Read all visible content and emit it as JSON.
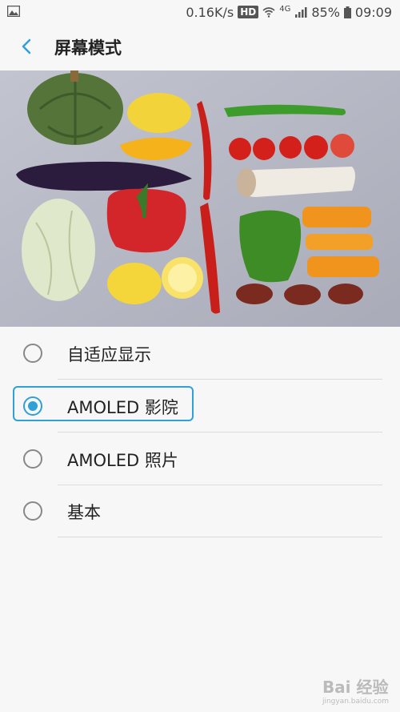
{
  "statusbar": {
    "speed": "0.16K/s",
    "hd": "HD",
    "network": "4G",
    "battery": "85%",
    "time": "09:09"
  },
  "appbar": {
    "title": "屏幕模式"
  },
  "options": [
    {
      "label": "自适应显示",
      "selected": false
    },
    {
      "label": "AMOLED 影院",
      "selected": true
    },
    {
      "label": "AMOLED 照片",
      "selected": false
    },
    {
      "label": "基本",
      "selected": false
    }
  ],
  "watermark": {
    "brand": "Bai 经验",
    "url": "jingyan.baidu.com"
  },
  "colors": {
    "accent": "#2fa0d8",
    "background": "#f7f7f7"
  }
}
